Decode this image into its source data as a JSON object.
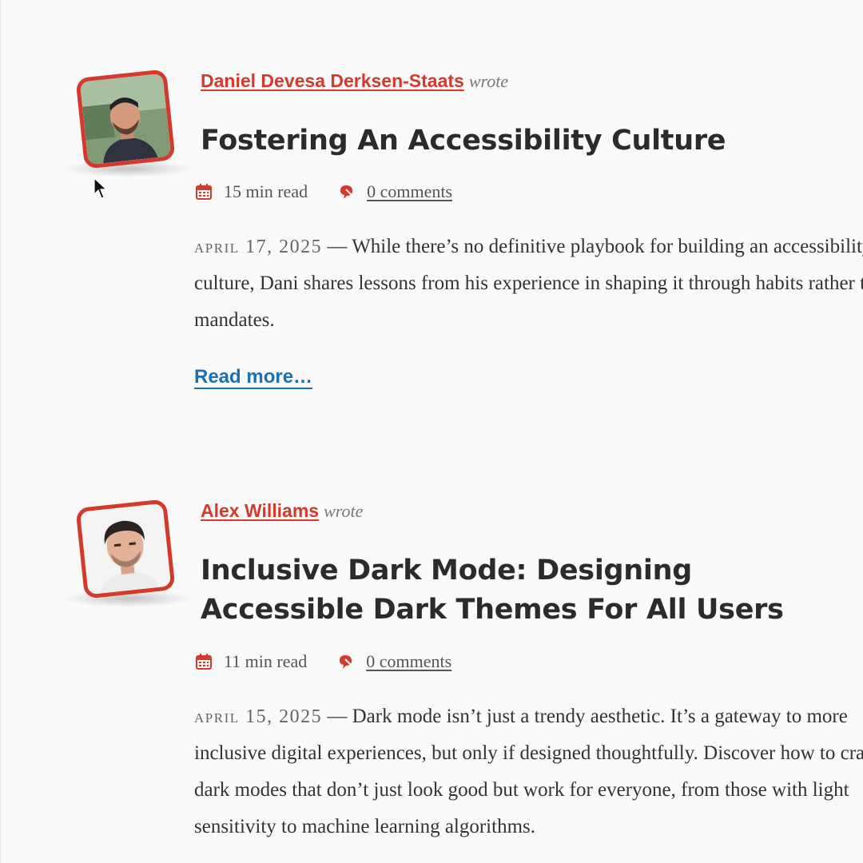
{
  "articles": [
    {
      "author": "Daniel Devesa Derksen-Staats",
      "wrote_label": "wrote",
      "title": "Fostering An Accessibility Culture",
      "read_time": "15 min read",
      "comments": "0 comments",
      "date": "April 17, 2025",
      "separator": "—",
      "excerpt": "While there’s no definitive playbook for building an accessibility culture, Dani shares lessons from his experience in shaping it through habits rather than mandates.",
      "read_more": "Read more…"
    },
    {
      "author": "Alex Williams",
      "wrote_label": "wrote",
      "title": "Inclusive Dark Mode: Designing Accessible Dark Themes For All Users",
      "read_time": "11 min read",
      "comments": "0 comments",
      "date": "April 15, 2025",
      "separator": "—",
      "excerpt": "Dark mode isn’t just a trendy aesthetic. It’s a gateway to more inclusive digital experiences, but only if designed thoughtfully. Discover how to craft dark modes that don’t just look good but work for everyone, from those with light sensitivity to machine learning algorithms."
    }
  ],
  "icons": {
    "calendar": "calendar-icon",
    "comment": "comment-icon",
    "cursor": "mouse-pointer-icon"
  },
  "colors": {
    "accent": "#d33a2c",
    "link": "#1a6fb5",
    "heading": "#2b2b2b",
    "text": "#333333",
    "muted": "#777777",
    "background": "#fafafa"
  }
}
